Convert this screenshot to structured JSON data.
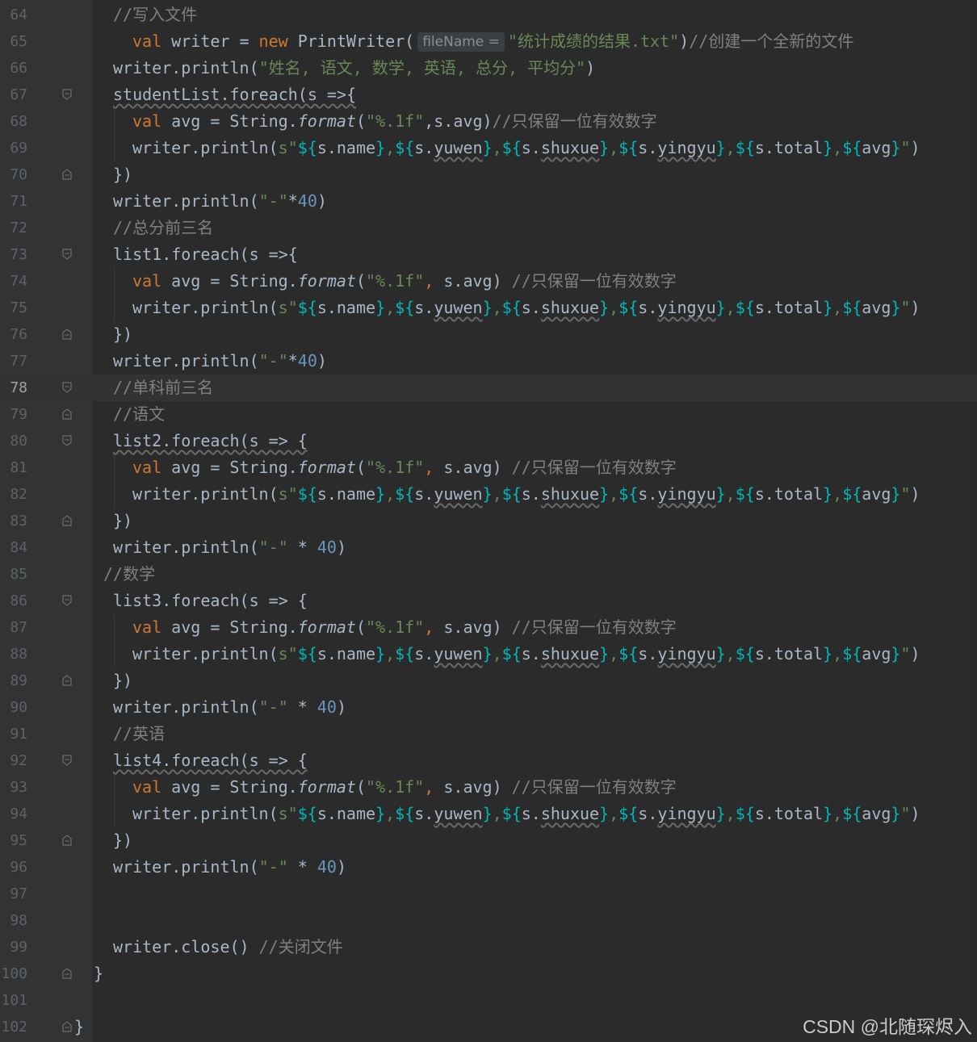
{
  "editor": {
    "hint_filename": "fileName =",
    "watermark": "CSDN @北随琛烬入"
  },
  "lines": [
    {
      "num": "64",
      "tokens": [
        [
          "cmt",
          "//写入文件"
        ]
      ]
    },
    {
      "num": "65",
      "tokens": [
        [
          "kw",
          "val "
        ],
        [
          "p",
          "writer = "
        ],
        [
          "kw",
          "new "
        ],
        [
          "p",
          "PrintWriter("
        ],
        [
          "hint",
          "fileName ="
        ],
        [
          "str",
          "\"统计成绩的结果.txt\""
        ],
        [
          "p",
          ")"
        ],
        [
          "cmt",
          "//创建一个全新的文件"
        ]
      ]
    },
    {
      "num": "66",
      "tokens": [
        [
          "p",
          "writer.println("
        ],
        [
          "str",
          "\"姓名, 语文, 数学, 英语, 总分, 平均分\""
        ],
        [
          "p",
          ")"
        ]
      ]
    },
    {
      "num": "67",
      "fold": "open",
      "tokens": [
        [
          "wv",
          "studentList.foreach(s =>{"
        ]
      ]
    },
    {
      "num": "68",
      "tokens": [
        [
          "kw",
          "val "
        ],
        [
          "p",
          "avg = String."
        ],
        [
          "it",
          "format"
        ],
        [
          "p",
          "("
        ],
        [
          "str",
          "\"%.1f\""
        ],
        [
          "p",
          ",s.avg)"
        ],
        [
          "cmt",
          "//只保留一位有效数字"
        ]
      ]
    },
    {
      "num": "69",
      "tokens": [
        [
          "p",
          "writer.println("
        ],
        [
          "str",
          "s\""
        ],
        [
          "tmpl",
          "${"
        ],
        [
          "p",
          "s.name"
        ],
        [
          "tmpl",
          "}"
        ],
        [
          "str",
          ","
        ],
        [
          "tmpl",
          "${"
        ],
        [
          "p",
          "s."
        ],
        [
          "wv",
          "yuwen"
        ],
        [
          "tmpl",
          "}"
        ],
        [
          "str",
          ","
        ],
        [
          "tmpl",
          "${"
        ],
        [
          "p",
          "s."
        ],
        [
          "wv",
          "shuxue"
        ],
        [
          "tmpl",
          "}"
        ],
        [
          "str",
          ","
        ],
        [
          "tmpl",
          "${"
        ],
        [
          "p",
          "s."
        ],
        [
          "wv",
          "yingyu"
        ],
        [
          "tmpl",
          "}"
        ],
        [
          "str",
          ","
        ],
        [
          "tmpl",
          "${"
        ],
        [
          "p",
          "s.total"
        ],
        [
          "tmpl",
          "}"
        ],
        [
          "str",
          ","
        ],
        [
          "tmpl",
          "${"
        ],
        [
          "p",
          "avg"
        ],
        [
          "tmpl",
          "}"
        ],
        [
          "str",
          "\""
        ],
        [
          "p",
          ")"
        ]
      ]
    },
    {
      "num": "70",
      "fold": "close",
      "tokens": [
        [
          "p",
          "})"
        ]
      ]
    },
    {
      "num": "71",
      "tokens": [
        [
          "p",
          "writer.println("
        ],
        [
          "str",
          "\"-\""
        ],
        [
          "p",
          "*"
        ],
        [
          "num",
          "40"
        ],
        [
          "p",
          ")"
        ]
      ]
    },
    {
      "num": "72",
      "tokens": [
        [
          "cmt",
          "//总分前三名"
        ]
      ]
    },
    {
      "num": "73",
      "fold": "open",
      "tokens": [
        [
          "p",
          "list1.foreach(s =>{"
        ]
      ]
    },
    {
      "num": "74",
      "tokens": [
        [
          "kw",
          "val "
        ],
        [
          "p",
          "avg = String."
        ],
        [
          "it",
          "format"
        ],
        [
          "p",
          "("
        ],
        [
          "str",
          "\"%.1f\""
        ],
        [
          "kw",
          ", "
        ],
        [
          "p",
          "s.avg) "
        ],
        [
          "cmt",
          "//只保留一位有效数字"
        ]
      ]
    },
    {
      "num": "75",
      "tokens": [
        [
          "p",
          "writer.println("
        ],
        [
          "str",
          "s\""
        ],
        [
          "tmpl",
          "${"
        ],
        [
          "p",
          "s.name"
        ],
        [
          "tmpl",
          "}"
        ],
        [
          "str",
          ","
        ],
        [
          "tmpl",
          "${"
        ],
        [
          "p",
          "s."
        ],
        [
          "wv",
          "yuwen"
        ],
        [
          "tmpl",
          "}"
        ],
        [
          "str",
          ","
        ],
        [
          "tmpl",
          "${"
        ],
        [
          "p",
          "s."
        ],
        [
          "wv",
          "shuxue"
        ],
        [
          "tmpl",
          "}"
        ],
        [
          "str",
          ","
        ],
        [
          "tmpl",
          "${"
        ],
        [
          "p",
          "s."
        ],
        [
          "wv",
          "yingyu"
        ],
        [
          "tmpl",
          "}"
        ],
        [
          "str",
          ","
        ],
        [
          "tmpl",
          "${"
        ],
        [
          "p",
          "s.total"
        ],
        [
          "tmpl",
          "}"
        ],
        [
          "str",
          ","
        ],
        [
          "tmpl",
          "${"
        ],
        [
          "p",
          "avg"
        ],
        [
          "tmpl",
          "}"
        ],
        [
          "str",
          "\""
        ],
        [
          "p",
          ")"
        ]
      ]
    },
    {
      "num": "76",
      "fold": "close",
      "tokens": [
        [
          "p",
          "})"
        ]
      ]
    },
    {
      "num": "77",
      "tokens": [
        [
          "p",
          "writer.println("
        ],
        [
          "str",
          "\"-\""
        ],
        [
          "p",
          "*"
        ],
        [
          "num",
          "40"
        ],
        [
          "p",
          ")"
        ]
      ]
    },
    {
      "num": "78",
      "current": true,
      "fold": "open",
      "tokens": [
        [
          "cmt",
          "//单科前三名"
        ]
      ]
    },
    {
      "num": "79",
      "fold": "close",
      "tokens": [
        [
          "cmt",
          "//语文"
        ]
      ]
    },
    {
      "num": "80",
      "fold": "open",
      "tokens": [
        [
          "wv",
          "list2.foreach(s => {"
        ]
      ]
    },
    {
      "num": "81",
      "tokens": [
        [
          "kw",
          "val "
        ],
        [
          "p",
          "avg = String."
        ],
        [
          "it",
          "format"
        ],
        [
          "p",
          "("
        ],
        [
          "str",
          "\"%.1f\""
        ],
        [
          "kw",
          ", "
        ],
        [
          "p",
          "s.avg) "
        ],
        [
          "cmt",
          "//只保留一位有效数字"
        ]
      ]
    },
    {
      "num": "82",
      "tokens": [
        [
          "p",
          "writer.println("
        ],
        [
          "str",
          "s\""
        ],
        [
          "tmpl",
          "${"
        ],
        [
          "p",
          "s.name"
        ],
        [
          "tmpl",
          "}"
        ],
        [
          "str",
          ","
        ],
        [
          "tmpl",
          "${"
        ],
        [
          "p",
          "s."
        ],
        [
          "wv",
          "yuwen"
        ],
        [
          "tmpl",
          "}"
        ],
        [
          "str",
          ","
        ],
        [
          "tmpl",
          "${"
        ],
        [
          "p",
          "s."
        ],
        [
          "wv",
          "shuxue"
        ],
        [
          "tmpl",
          "}"
        ],
        [
          "str",
          ","
        ],
        [
          "tmpl",
          "${"
        ],
        [
          "p",
          "s."
        ],
        [
          "wv",
          "yingyu"
        ],
        [
          "tmpl",
          "}"
        ],
        [
          "str",
          ","
        ],
        [
          "tmpl",
          "${"
        ],
        [
          "p",
          "s.total"
        ],
        [
          "tmpl",
          "}"
        ],
        [
          "str",
          ","
        ],
        [
          "tmpl",
          "${"
        ],
        [
          "p",
          "avg"
        ],
        [
          "tmpl",
          "}"
        ],
        [
          "str",
          "\""
        ],
        [
          "p",
          ")"
        ]
      ]
    },
    {
      "num": "83",
      "fold": "close",
      "tokens": [
        [
          "p",
          "})"
        ]
      ]
    },
    {
      "num": "84",
      "tokens": [
        [
          "p",
          "writer.println("
        ],
        [
          "str",
          "\"-\""
        ],
        [
          "p",
          " * "
        ],
        [
          "num",
          "40"
        ],
        [
          "p",
          ")"
        ]
      ]
    },
    {
      "num": "85",
      "shift": true,
      "tokens": [
        [
          "cmt",
          "//数学"
        ]
      ]
    },
    {
      "num": "86",
      "fold": "open",
      "tokens": [
        [
          "p",
          "list3.foreach(s => {"
        ]
      ]
    },
    {
      "num": "87",
      "tokens": [
        [
          "kw",
          "val "
        ],
        [
          "p",
          "avg = String."
        ],
        [
          "it",
          "format"
        ],
        [
          "p",
          "("
        ],
        [
          "str",
          "\"%.1f\""
        ],
        [
          "kw",
          ", "
        ],
        [
          "p",
          "s.avg) "
        ],
        [
          "cmt",
          "//只保留一位有效数字"
        ]
      ]
    },
    {
      "num": "88",
      "tokens": [
        [
          "p",
          "writer.println("
        ],
        [
          "str",
          "s\""
        ],
        [
          "tmpl",
          "${"
        ],
        [
          "p",
          "s.name"
        ],
        [
          "tmpl",
          "}"
        ],
        [
          "str",
          ","
        ],
        [
          "tmpl",
          "${"
        ],
        [
          "p",
          "s."
        ],
        [
          "wv",
          "yuwen"
        ],
        [
          "tmpl",
          "}"
        ],
        [
          "str",
          ","
        ],
        [
          "tmpl",
          "${"
        ],
        [
          "p",
          "s."
        ],
        [
          "wv",
          "shuxue"
        ],
        [
          "tmpl",
          "}"
        ],
        [
          "str",
          ","
        ],
        [
          "tmpl",
          "${"
        ],
        [
          "p",
          "s."
        ],
        [
          "wv",
          "yingyu"
        ],
        [
          "tmpl",
          "}"
        ],
        [
          "str",
          ","
        ],
        [
          "tmpl",
          "${"
        ],
        [
          "p",
          "s.total"
        ],
        [
          "tmpl",
          "}"
        ],
        [
          "str",
          ","
        ],
        [
          "tmpl",
          "${"
        ],
        [
          "p",
          "avg"
        ],
        [
          "tmpl",
          "}"
        ],
        [
          "str",
          "\""
        ],
        [
          "p",
          ")"
        ]
      ]
    },
    {
      "num": "89",
      "fold": "close",
      "tokens": [
        [
          "p",
          "})"
        ]
      ]
    },
    {
      "num": "90",
      "tokens": [
        [
          "p",
          "writer.println("
        ],
        [
          "str",
          "\"-\""
        ],
        [
          "p",
          " * "
        ],
        [
          "num",
          "40"
        ],
        [
          "p",
          ")"
        ]
      ]
    },
    {
      "num": "91",
      "tokens": [
        [
          "cmt",
          "//英语"
        ]
      ]
    },
    {
      "num": "92",
      "fold": "open",
      "tokens": [
        [
          "wv",
          "list4.foreach(s => {"
        ]
      ]
    },
    {
      "num": "93",
      "tokens": [
        [
          "kw",
          "val "
        ],
        [
          "p",
          "avg = String."
        ],
        [
          "it",
          "format"
        ],
        [
          "p",
          "("
        ],
        [
          "str",
          "\"%.1f\""
        ],
        [
          "kw",
          ", "
        ],
        [
          "p",
          "s.avg) "
        ],
        [
          "cmt",
          "//只保留一位有效数字"
        ]
      ]
    },
    {
      "num": "94",
      "tokens": [
        [
          "p",
          "writer.println("
        ],
        [
          "str",
          "s\""
        ],
        [
          "tmpl",
          "${"
        ],
        [
          "p",
          "s.name"
        ],
        [
          "tmpl",
          "}"
        ],
        [
          "str",
          ","
        ],
        [
          "tmpl",
          "${"
        ],
        [
          "p",
          "s."
        ],
        [
          "wv",
          "yuwen"
        ],
        [
          "tmpl",
          "}"
        ],
        [
          "str",
          ","
        ],
        [
          "tmpl",
          "${"
        ],
        [
          "p",
          "s."
        ],
        [
          "wv",
          "shuxue"
        ],
        [
          "tmpl",
          "}"
        ],
        [
          "str",
          ","
        ],
        [
          "tmpl",
          "${"
        ],
        [
          "p",
          "s."
        ],
        [
          "wv",
          "yingyu"
        ],
        [
          "tmpl",
          "}"
        ],
        [
          "str",
          ","
        ],
        [
          "tmpl",
          "${"
        ],
        [
          "p",
          "s.total"
        ],
        [
          "tmpl",
          "}"
        ],
        [
          "str",
          ","
        ],
        [
          "tmpl",
          "${"
        ],
        [
          "p",
          "avg"
        ],
        [
          "tmpl",
          "}"
        ],
        [
          "str",
          "\""
        ],
        [
          "p",
          ")"
        ]
      ]
    },
    {
      "num": "95",
      "fold": "close",
      "tokens": [
        [
          "p",
          "})"
        ]
      ]
    },
    {
      "num": "96",
      "tokens": [
        [
          "p",
          "writer.println("
        ],
        [
          "str",
          "\"-\""
        ],
        [
          "p",
          " * "
        ],
        [
          "num",
          "40"
        ],
        [
          "p",
          ")"
        ]
      ]
    },
    {
      "num": "97",
      "tokens": []
    },
    {
      "num": "98",
      "tokens": []
    },
    {
      "num": "99",
      "tokens": [
        [
          "p",
          "writer.close() "
        ],
        [
          "cmt",
          "//关闭文件"
        ]
      ]
    },
    {
      "num": "100",
      "outer": true,
      "fold": "close",
      "tokens": [
        [
          "p",
          "}"
        ]
      ]
    },
    {
      "num": "101",
      "tokens": []
    },
    {
      "num": "102",
      "outer2": true,
      "fold": "close",
      "tokens": [
        [
          "p",
          "}"
        ]
      ]
    }
  ]
}
